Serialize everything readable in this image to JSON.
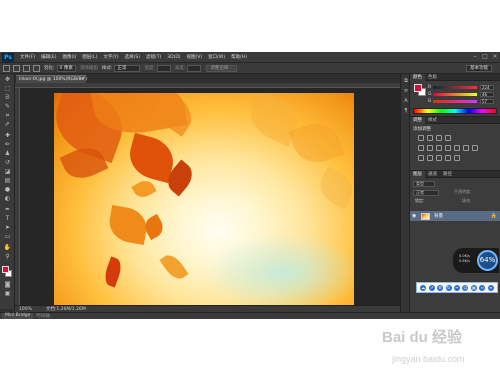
{
  "app": {
    "logo": "Ps",
    "menu": [
      "文件(F)",
      "编辑(E)",
      "图像(I)",
      "图层(L)",
      "文字(Y)",
      "选择(S)",
      "滤镜(T)",
      "3D(D)",
      "视图(V)",
      "窗口(W)",
      "帮助(H)"
    ],
    "window_controls": [
      "–",
      "□",
      "×"
    ]
  },
  "options_bar": {
    "feather_label": "羽化:",
    "feather_value": "0 像素",
    "antialias_label": "消除锯齿",
    "style_label": "样式:",
    "style_value": "正常",
    "width_label": "宽度:",
    "height_label": "高度:",
    "refine_edge_button": "调整边缘...",
    "workspace": "基本功能"
  },
  "document": {
    "tab_title": "Inkon-0l.jpg @ 100%(RGB/8#)",
    "zoom": "100%",
    "doc_info": "文档:1.26M/1.26M"
  },
  "mini_bridge": {
    "tab1": "Mini Bridge",
    "tab2": "时间轴"
  },
  "color_panel": {
    "tabs": [
      "颜色",
      "色板"
    ],
    "r_label": "R",
    "r_value": "224",
    "g_label": "G",
    "g_value": "46",
    "b_label": "B",
    "b_value": "57",
    "foreground_color": "#d3123b",
    "background_color": "#ffffff"
  },
  "adjustments_panel": {
    "tabs": [
      "调整",
      "样式"
    ],
    "title": "添加调整"
  },
  "layers_panel": {
    "tabs": [
      "图层",
      "通道",
      "路径"
    ],
    "filter_label": "类型",
    "blend_mode": "正常",
    "opacity_label": "不透明度:",
    "lock_label": "锁定:",
    "fill_label": "填充:",
    "layer_name": "背景"
  },
  "net_widget": {
    "upload": "0.0K/s",
    "download": "5.6K/s",
    "percent": "64%"
  },
  "watermark": {
    "logo": "Bai du 经验",
    "url": "jingyan.baidu.com"
  }
}
